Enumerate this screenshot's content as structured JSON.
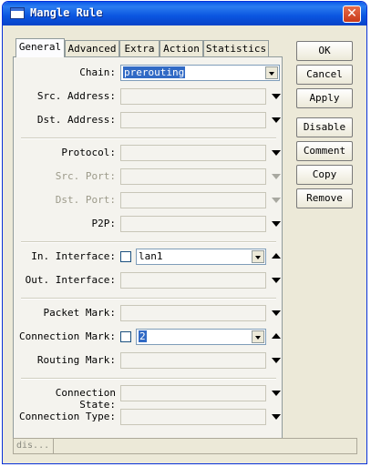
{
  "window": {
    "title": "Mangle Rule"
  },
  "tabs": [
    "General",
    "Advanced",
    "Extra",
    "Action",
    "Statistics"
  ],
  "buttons": [
    "OK",
    "Cancel",
    "Apply",
    "Disable",
    "Comment",
    "Copy",
    "Remove"
  ],
  "fields": {
    "chain": {
      "label": "Chain:",
      "value": "prerouting"
    },
    "src_address": {
      "label": "Src. Address:"
    },
    "dst_address": {
      "label": "Dst. Address:"
    },
    "protocol": {
      "label": "Protocol:"
    },
    "src_port": {
      "label": "Src. Port:"
    },
    "dst_port": {
      "label": "Dst. Port:"
    },
    "p2p": {
      "label": "P2P:"
    },
    "in_interface": {
      "label": "In. Interface:",
      "value": "lan1"
    },
    "out_interface": {
      "label": "Out. Interface:"
    },
    "packet_mark": {
      "label": "Packet Mark:"
    },
    "connection_mark": {
      "label": "Connection Mark:",
      "value": "2"
    },
    "routing_mark": {
      "label": "Routing Mark:"
    },
    "connection_state": {
      "label": "Connection State:"
    },
    "connection_type": {
      "label": "Connection Type:"
    }
  },
  "status": {
    "text": "dis..."
  }
}
